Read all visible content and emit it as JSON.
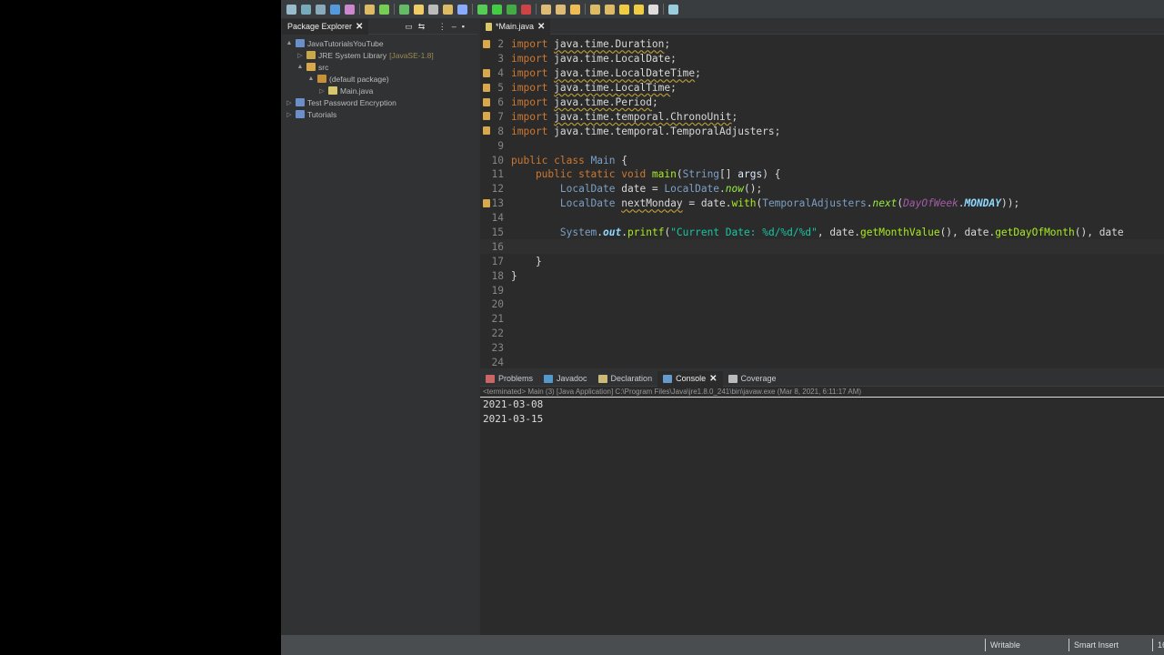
{
  "package_explorer": {
    "title": "Package Explorer",
    "tree": [
      {
        "label": "JavaTutorialsYouTube",
        "depth": 0,
        "twisty": "▲",
        "icon": "#6a8fc9"
      },
      {
        "label": "JRE System Library",
        "deco": "[JavaSE-1.8]",
        "depth": 1,
        "twisty": "▷",
        "icon": "#c9a84a"
      },
      {
        "label": "src",
        "depth": 1,
        "twisty": "▲",
        "icon": "#d8a84a"
      },
      {
        "label": "(default package)",
        "depth": 2,
        "twisty": "▲",
        "icon": "#c9903a"
      },
      {
        "label": "Main.java",
        "depth": 3,
        "twisty": "▷",
        "icon": "#d8c66a"
      },
      {
        "label": "Test Password Encryption",
        "depth": 0,
        "twisty": "▷",
        "icon": "#6a8fc9"
      },
      {
        "label": "Tutorials",
        "depth": 0,
        "twisty": "▷",
        "icon": "#6a8fc9"
      }
    ]
  },
  "editor": {
    "tab": "*Main.java",
    "lines": [
      {
        "n": "2",
        "mk": true,
        "t": [
          [
            "kw",
            "import "
          ],
          [
            "id ul",
            "java.time.Duration"
          ],
          [
            "id",
            ";"
          ]
        ]
      },
      {
        "n": "3",
        "t": [
          [
            "kw",
            "import "
          ],
          [
            "id",
            "java.time.LocalDate;"
          ]
        ]
      },
      {
        "n": "4",
        "mk": true,
        "t": [
          [
            "kw",
            "import "
          ],
          [
            "id ul",
            "java.time.LocalDateTime"
          ],
          [
            "id",
            ";"
          ]
        ]
      },
      {
        "n": "5",
        "mk": true,
        "t": [
          [
            "kw",
            "import "
          ],
          [
            "id ul",
            "java.time.LocalTime"
          ],
          [
            "id",
            ";"
          ]
        ]
      },
      {
        "n": "6",
        "mk": true,
        "t": [
          [
            "kw",
            "import "
          ],
          [
            "id ul",
            "java.time.Period"
          ],
          [
            "id",
            ";"
          ]
        ]
      },
      {
        "n": "7",
        "mk": true,
        "t": [
          [
            "kw",
            "import "
          ],
          [
            "id ul",
            "java.time.temporal.ChronoUnit"
          ],
          [
            "id",
            ";"
          ]
        ]
      },
      {
        "n": "8",
        "mk": true,
        "t": [
          [
            "kw",
            "import "
          ],
          [
            "id",
            "java.time.temporal.TemporalAdjusters;"
          ]
        ]
      },
      {
        "n": "9",
        "t": []
      },
      {
        "n": "10",
        "t": [
          [
            "kw",
            "public class "
          ],
          [
            "ty",
            "Main"
          ],
          [
            "id",
            " {"
          ]
        ]
      },
      {
        "n": "11",
        "t": [
          [
            "kw",
            "    public static void "
          ],
          [
            "me",
            "main"
          ],
          [
            "id",
            "("
          ],
          [
            "ty",
            "String"
          ],
          [
            "id",
            "[] "
          ],
          [
            "pl",
            "args"
          ],
          [
            "id",
            ") {"
          ]
        ]
      },
      {
        "n": "12",
        "t": [
          [
            "ty",
            "        LocalDate "
          ],
          [
            "id",
            "date = "
          ],
          [
            "ty",
            "LocalDate"
          ],
          [
            "id",
            "."
          ],
          [
            "it",
            "now"
          ],
          [
            "id",
            "();"
          ]
        ]
      },
      {
        "n": "13",
        "mk": true,
        "t": [
          [
            "ty",
            "        LocalDate "
          ],
          [
            "id ul",
            "nextMonday"
          ],
          [
            "id",
            " = date."
          ],
          [
            "me",
            "with"
          ],
          [
            "id",
            "("
          ],
          [
            "ty",
            "TemporalAdjusters"
          ],
          [
            "id",
            "."
          ],
          [
            "it",
            "next"
          ],
          [
            "id",
            "("
          ],
          [
            "en",
            "DayOfWeek"
          ],
          [
            "id",
            "."
          ],
          [
            "ef",
            "MONDAY"
          ],
          [
            "id",
            "));"
          ]
        ]
      },
      {
        "n": "14",
        "t": []
      },
      {
        "n": "15",
        "t": [
          [
            "ty",
            "        System"
          ],
          [
            "id",
            "."
          ],
          [
            "fi",
            "out"
          ],
          [
            "id",
            "."
          ],
          [
            "me",
            "printf"
          ],
          [
            "id",
            "("
          ],
          [
            "st",
            "\"Current Date: %d/%d/%d\""
          ],
          [
            "id",
            ", date."
          ],
          [
            "me",
            "getMonthValue"
          ],
          [
            "id",
            "(), date."
          ],
          [
            "me",
            "getDayOfMonth"
          ],
          [
            "id",
            "(), date"
          ]
        ]
      },
      {
        "n": "16",
        "hl": true,
        "t": []
      },
      {
        "n": "17",
        "t": [
          [
            "id",
            "    }"
          ]
        ]
      },
      {
        "n": "18",
        "t": [
          [
            "id",
            "}"
          ]
        ]
      },
      {
        "n": "19",
        "t": []
      },
      {
        "n": "20",
        "t": []
      },
      {
        "n": "21",
        "t": []
      },
      {
        "n": "22",
        "t": []
      },
      {
        "n": "23",
        "t": []
      },
      {
        "n": "24",
        "t": []
      }
    ]
  },
  "bottom_tabs": [
    "Problems",
    "Javadoc",
    "Declaration",
    "Console",
    "Coverage"
  ],
  "console": {
    "info": "<terminated> Main (3) [Java Application] C:\\Program Files\\Java\\jre1.8.0_241\\bin\\javaw.exe (Mar 8, 2021, 6:11:17 AM)",
    "output": [
      "2021-03-08",
      "2021-03-15"
    ]
  },
  "status": {
    "writable": "Writable",
    "insert": "Smart Insert",
    "position": "16"
  }
}
